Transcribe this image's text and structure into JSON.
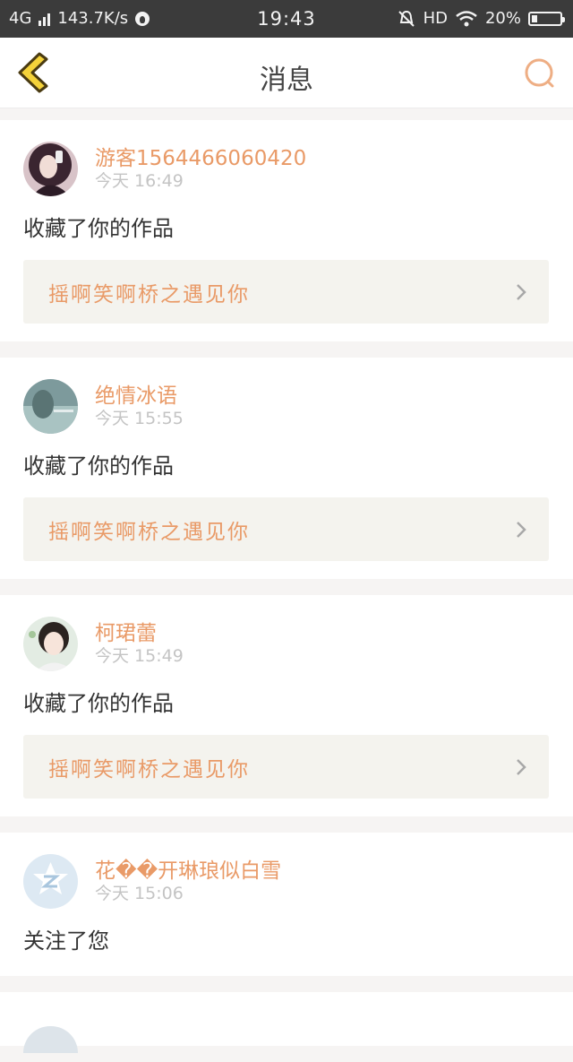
{
  "status_bar": {
    "network": "4G",
    "speed": "143.7K/s",
    "time": "19:43",
    "hd": "HD",
    "battery_text": "20%",
    "battery_level": 0.2
  },
  "header": {
    "title": "消息"
  },
  "colors": {
    "accent": "#e99a67",
    "back_arrow_fill": "#f4d23a",
    "back_arrow_stroke": "#4a3b12"
  },
  "messages": [
    {
      "username": "游客1564466060420",
      "time": "今天 16:49",
      "action": "收藏了你的作品",
      "work_title": "摇啊笑啊桥之遇见你"
    },
    {
      "username": "绝情冰语",
      "time": "今天 15:55",
      "action": "收藏了你的作品",
      "work_title": "摇啊笑啊桥之遇见你"
    },
    {
      "username": "柯珺蕾",
      "time": "今天 15:49",
      "action": "收藏了你的作品",
      "work_title": "摇啊笑啊桥之遇见你"
    },
    {
      "username": "花��开琳琅似白雪",
      "time": "今天 15:06",
      "action": "关注了您"
    }
  ]
}
